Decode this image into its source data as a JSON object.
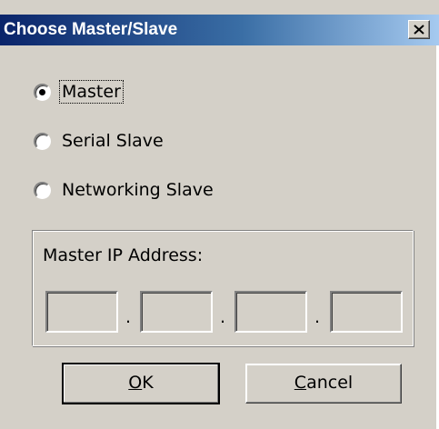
{
  "window": {
    "title": "Choose Master/Slave"
  },
  "icons": {
    "close": "close-icon"
  },
  "mode_options": [
    {
      "label": "Master",
      "selected": true
    },
    {
      "label": "Serial Slave",
      "selected": false
    },
    {
      "label": "Networking Slave",
      "selected": false
    }
  ],
  "ip_group": {
    "label": "Master IP Address:",
    "octets": [
      "",
      "",
      "",
      ""
    ],
    "separator": "."
  },
  "buttons": {
    "ok": {
      "mnemonic": "O",
      "rest": "K"
    },
    "cancel": {
      "mnemonic": "C",
      "rest": "ancel"
    }
  },
  "colors": {
    "face": "#d4d0c8",
    "title_start": "#0a246a",
    "title_end": "#a6caf0"
  }
}
